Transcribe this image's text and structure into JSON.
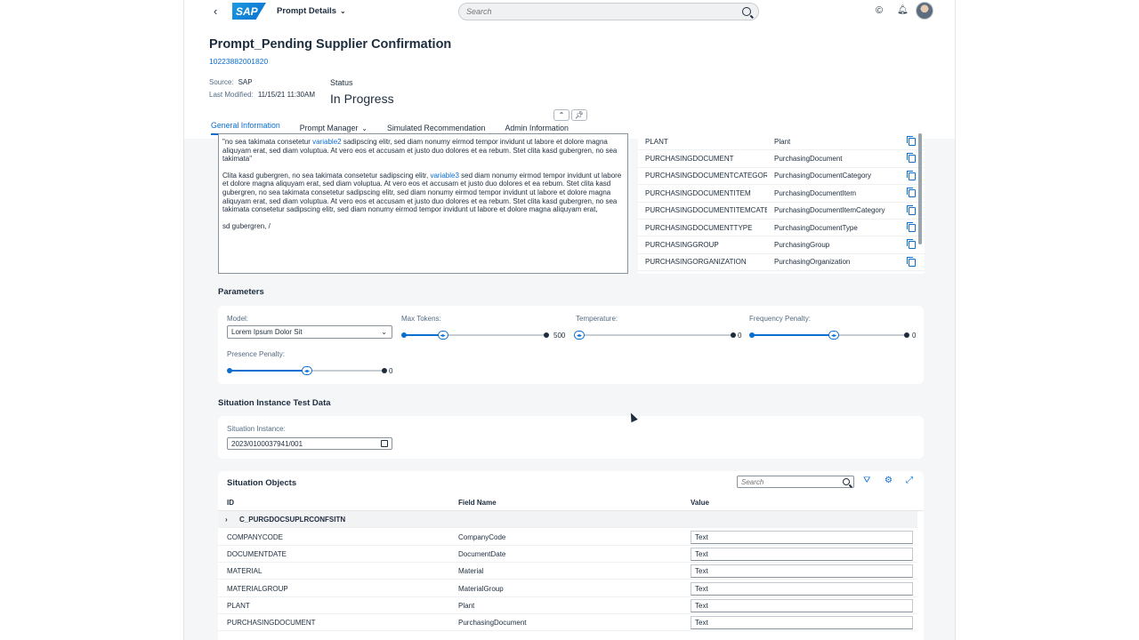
{
  "shell": {
    "app_title": "Prompt Details",
    "search_placeholder": "Search",
    "logo": "SAP"
  },
  "header": {
    "title": "Prompt_Pending Supplier Confirmation",
    "id": "10223882001820",
    "source_label": "Source:",
    "source_value": "SAP",
    "modified_label": "Last Modified:",
    "modified_value": "11/15/21 11:30AM",
    "status_label": "Status",
    "status_value": "In Progress"
  },
  "tabs": [
    {
      "label": "General Information",
      "active": true
    },
    {
      "label": "Prompt Manager",
      "dropdown": true
    },
    {
      "label": "Simulated Recommendation"
    },
    {
      "label": "Admin Information"
    }
  ],
  "prompt_text": {
    "p1_pre": "\"no sea takimata consetetur ",
    "p1_var": "variable2",
    "p1_post": " sadipscing elitr, sed diam nonumy eirmod tempor invidunt ut labore et dolore magna aliquyam erat, sed diam voluptua. At vero eos et accusam et justo duo dolores et ea rebum. Stet clita kasd gubergren, no sea takimata\"",
    "p2_pre": "Clita kasd gubergren, no sea takimata consetetur sadipscing elitr, ",
    "p2_var": "variable3",
    "p2_post": " sed diam nonumy eirmod tempor invidunt ut labore et dolore magna aliquyam erat, sed diam voluptua. At vero eos et accusam et justo duo dolores et ea rebum. Stet clita kasd gubergren, no sea takimata consetetur sadipscing elitr, sed diam nonumy eirmod tempor invidunt ut labore et dolore magna aliquyam erat, sed diam voluptua. At vero eos et accusam et justo duo dolores et ea rebum. Stet clita kasd gubergren, no sea takimata consetetur sadipscing elitr, sed diam nonumy eirmod tempor invidunt ut labore et dolore magna aliquyam erat,",
    "p3": "sd gubergren,  /"
  },
  "field_list": [
    {
      "id": "PLANT",
      "name": "Plant"
    },
    {
      "id": "PURCHASINGDOCUMENT",
      "name": "PurchasingDocument"
    },
    {
      "id": "PURCHASINGDOCUMENTCATEGORY",
      "name": "PurchasingDocumentCategory"
    },
    {
      "id": "PURCHASINGDOCUMENTITEM",
      "name": "PurchasingDocumentItem"
    },
    {
      "id": "PURCHASINGDOCUMENTITEMCATEGORY",
      "name": "PurchasingDocumentItemCategory"
    },
    {
      "id": "PURCHASINGDOCUMENTTYPE",
      "name": "PurchasingDocumentType"
    },
    {
      "id": "PURCHASINGGROUP",
      "name": "PurchasingGroup"
    },
    {
      "id": "PURCHASINGORGANIZATION",
      "name": "PurchasingOrganization"
    }
  ],
  "parameters": {
    "title": "Parameters",
    "model_label": "Model:",
    "model_value": "Lorem Ipsum Dolor Sit",
    "max_tokens_label": "Max Tokens:",
    "max_tokens_max": "500",
    "max_tokens_level": 0.27,
    "temperature_label": "Temperature:",
    "temperature_max": "0",
    "temperature_level": 0.0,
    "frequency_label": "Frequency Penalty:",
    "frequency_max": "0",
    "frequency_level": 0.53,
    "presence_label": "Presence Penalty:",
    "presence_max": "0",
    "presence_level": 0.5
  },
  "test_data": {
    "title": "Situation Instance Test Data",
    "instance_label": "Situation Instance:",
    "instance_value": "2023/0100037941/001"
  },
  "objects": {
    "title": "Situation Objects",
    "search_placeholder": "Search",
    "col_id": "ID",
    "col_field": "Field Name",
    "col_value": "Value",
    "group": "C_PURGDOCSUPLRCONFSITN",
    "rows": [
      {
        "id": "COMPANYCODE",
        "field": "CompanyCode",
        "value": "Text"
      },
      {
        "id": "DOCUMENTDATE",
        "field": "DocumentDate",
        "value": "Text"
      },
      {
        "id": "MATERIAL",
        "field": "Material",
        "value": "Text"
      },
      {
        "id": "MATERIALGROUP",
        "field": "MaterialGroup",
        "value": "Text"
      },
      {
        "id": "PLANT",
        "field": "Plant",
        "value": "Text"
      },
      {
        "id": "PURCHASINGDOCUMENT",
        "field": "PurchasingDocument",
        "value": "Text"
      }
    ]
  },
  "colors": {
    "accent": "#0a6ed1",
    "text": "#1d2d3e",
    "background": "#f5f6f7"
  }
}
